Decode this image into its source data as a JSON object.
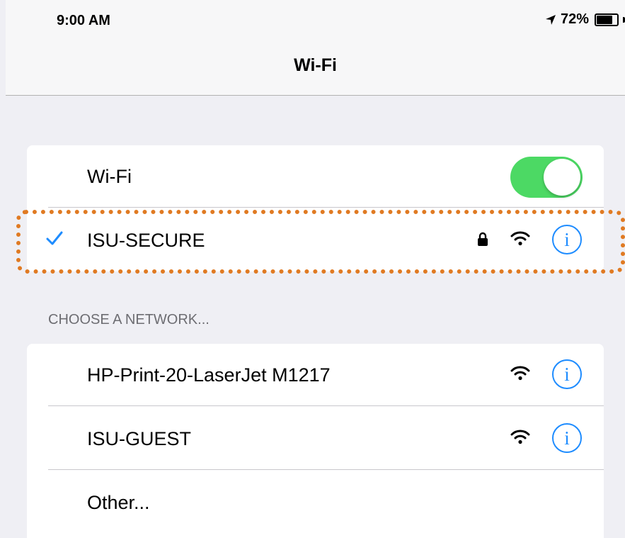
{
  "status_bar": {
    "time": "9:00 AM",
    "battery_text": "72%",
    "battery_level": 0.72,
    "location_icon": "location-arrow-icon",
    "battery_icon": "battery-icon"
  },
  "nav": {
    "title": "Wi-Fi"
  },
  "wifi_toggle": {
    "label": "Wi-Fi",
    "on": true
  },
  "connected_network": {
    "name": "ISU-SECURE",
    "selected": true,
    "secured": true,
    "icons": [
      "checkmark-icon",
      "lock-icon",
      "wifi-signal-icon",
      "info-icon"
    ],
    "info_glyph": "i"
  },
  "choose_section": {
    "header": "CHOOSE A NETWORK..."
  },
  "networks": [
    {
      "name": "HP-Print-20-LaserJet M1217",
      "secured": false,
      "info_glyph": "i"
    },
    {
      "name": "ISU-GUEST",
      "secured": false,
      "info_glyph": "i"
    },
    {
      "name": "Other...",
      "secured": false
    }
  ],
  "colors": {
    "background": "#efeff4",
    "toggle_on": "#4cd964",
    "accent_blue": "#1e8cff",
    "highlight_orange": "#e07a22"
  }
}
